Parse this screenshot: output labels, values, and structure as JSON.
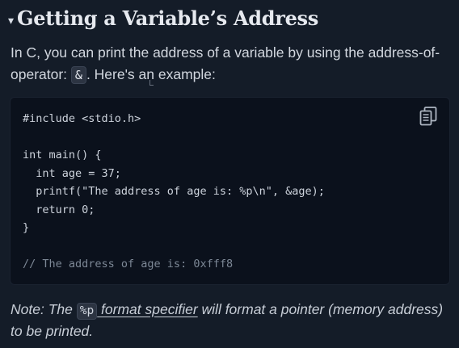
{
  "heading": {
    "caret": "▾",
    "text": "Getting a Variable’s Address"
  },
  "intro": {
    "before": "In C, you can print the address of a variable by using the address-of-operator: ",
    "inline_code": "&",
    "after": ". Here's an example:"
  },
  "code_block": {
    "copy_icon": "copy-icon",
    "lines": [
      "#include <stdio.h>",
      "",
      "int main() {",
      "  int age = 37;",
      "  printf(\"The address of age is: %p\\n\", &age);",
      "  return 0;",
      "}",
      "",
      "// The address of age is: 0xfff8"
    ]
  },
  "note": {
    "prefix": "Note: The ",
    "code": "%p",
    "link_suffix": " format specifier",
    "after": " will format a pointer (memory address) to be printed."
  },
  "colors": {
    "background": "#141c28",
    "code_background": "#0b111c",
    "inline_code_background": "#2c3442",
    "comment": "#7d8896"
  }
}
